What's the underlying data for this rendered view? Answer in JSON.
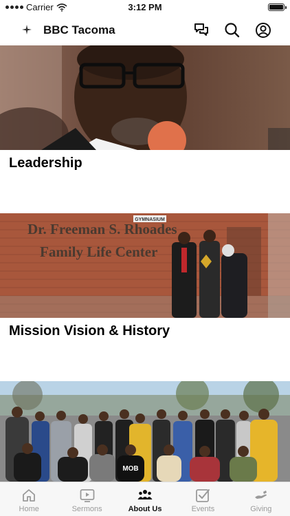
{
  "status_bar": {
    "carrier": "Carrier",
    "time": "3:12 PM"
  },
  "header": {
    "title": "BBC Tacoma"
  },
  "feed": {
    "cards": [
      {
        "title": "Leadership",
        "image_alt": "Pastor speaking at microphone"
      },
      {
        "title": "Mission Vision & History",
        "image_alt": "Group at Family Life Center entrance",
        "sign_line1": "Dr. Freeman S. Rhoades",
        "sign_line2": "Family Life Center",
        "sign_small": "GYMNASIUM"
      },
      {
        "title": "",
        "image_alt": "Large group photo outdoors",
        "shirt_text": "MOB"
      }
    ]
  },
  "tabbar": {
    "tabs": [
      {
        "label": "Home",
        "icon": "home-icon"
      },
      {
        "label": "Sermons",
        "icon": "play-icon"
      },
      {
        "label": "About Us",
        "icon": "people-icon",
        "active": true
      },
      {
        "label": "Events",
        "icon": "checkbox-icon"
      },
      {
        "label": "Giving",
        "icon": "hand-icon"
      }
    ]
  },
  "colors": {
    "accent": "#111111",
    "inactive": "#9a9a9a",
    "tabbar_bg": "#f7f7f7"
  }
}
